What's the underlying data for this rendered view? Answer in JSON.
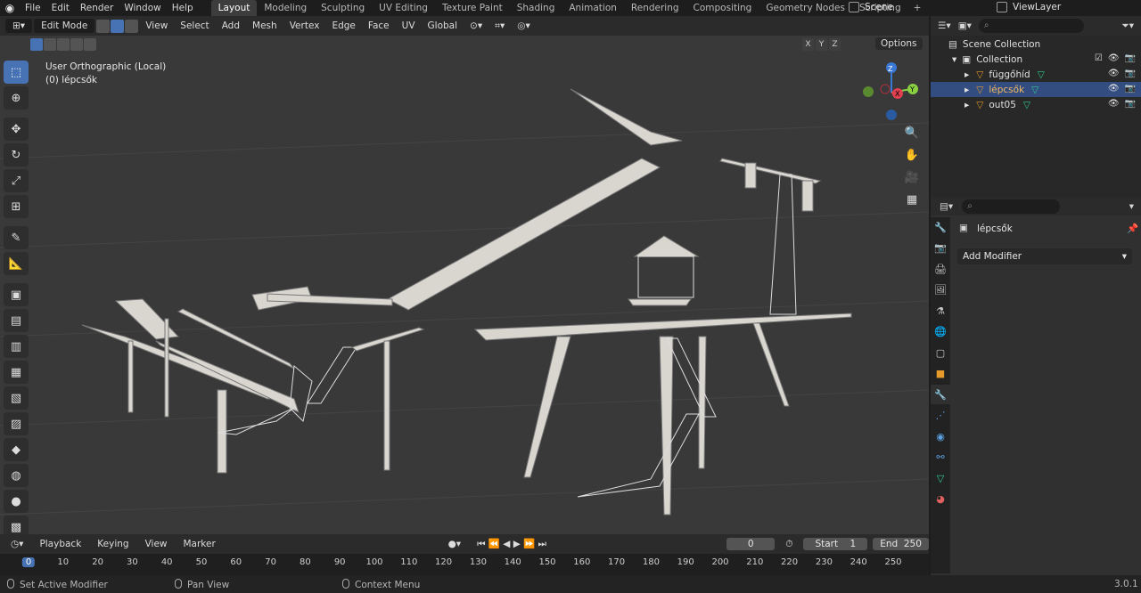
{
  "menu": [
    "File",
    "Edit",
    "Render",
    "Window",
    "Help"
  ],
  "workspaces": [
    "Layout",
    "Modeling",
    "Sculpting",
    "UV Editing",
    "Texture Paint",
    "Shading",
    "Animation",
    "Rendering",
    "Compositing",
    "Geometry Nodes",
    "Scripting"
  ],
  "workspace_add": "+",
  "scene": "Scene",
  "view_layer": "ViewLayer",
  "viewport": {
    "mode": "Edit Mode",
    "menus": [
      "View",
      "Select",
      "Add",
      "Mesh",
      "Vertex",
      "Edge",
      "Face",
      "UV"
    ],
    "orientation": "Global",
    "info_line1": "User Orthographic (Local)",
    "info_line2": "(0) lépcsők",
    "axes": [
      "X",
      "Y",
      "Z"
    ],
    "options": "Options",
    "gizmo": {
      "x": "X",
      "y": "Y",
      "z": "Z"
    }
  },
  "timeline": {
    "menus": [
      "Playback",
      "Keying",
      "View",
      "Marker"
    ],
    "current_frame": "0",
    "start_label": "Start",
    "start_value": "1",
    "end_label": "End",
    "end_value": "250",
    "ticks": [
      "0",
      "10",
      "20",
      "30",
      "40",
      "50",
      "60",
      "70",
      "80",
      "90",
      "100",
      "110",
      "120",
      "130",
      "140",
      "150",
      "160",
      "170",
      "180",
      "190",
      "200",
      "210",
      "220",
      "230",
      "240",
      "250"
    ]
  },
  "status": {
    "left": "Set Active Modifier",
    "middle": "Pan View",
    "right": "Context Menu",
    "version": "3.0.1"
  },
  "outliner": {
    "scene_collection": "Scene Collection",
    "collection": "Collection",
    "objects": [
      "függőhíd",
      "lépcsők",
      "out05"
    ]
  },
  "properties": {
    "object_name": "lépcsők",
    "add_modifier": "Add Modifier"
  }
}
